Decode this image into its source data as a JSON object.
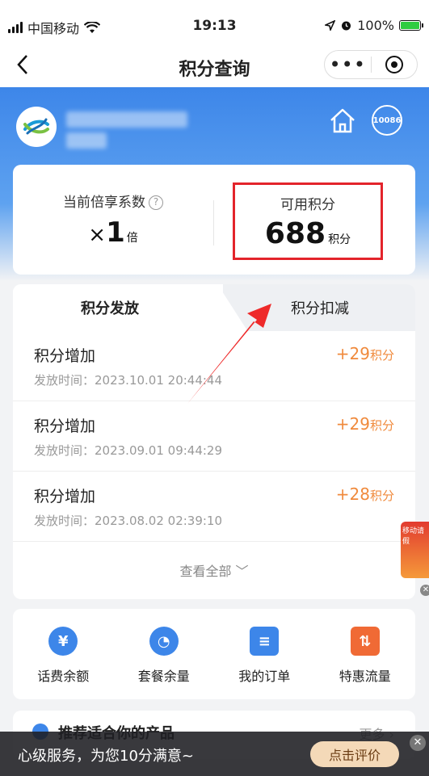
{
  "status_bar": {
    "carrier": "中国移动",
    "time": "19:13",
    "battery": "100%"
  },
  "nav": {
    "title": "积分查询",
    "more_icon": "•••"
  },
  "hero": {
    "service_icon": "10086"
  },
  "points": {
    "coef_label": "当前倍享系数",
    "coef_prefix": "×",
    "coef_value": "1",
    "coef_unit": "倍",
    "available_label": "可用积分",
    "available_value": "688",
    "available_unit": "积分"
  },
  "tabs": {
    "issue": "积分发放",
    "deduct": "积分扣减"
  },
  "records": [
    {
      "name": "积分增加",
      "time": "发放时间：2023.10.01 20:44:44",
      "points": "+29",
      "unit": "积分"
    },
    {
      "name": "积分增加",
      "time": "发放时间：2023.09.01 09:44:29",
      "points": "+29",
      "unit": "积分"
    },
    {
      "name": "积分增加",
      "time": "发放时间：2023.08.02 02:39:10",
      "points": "+28",
      "unit": "积分"
    }
  ],
  "view_all": "查看全部 ﹀",
  "shortcuts": [
    {
      "label": "话费余额",
      "icon": "¥",
      "color": "#3d86e9"
    },
    {
      "label": "套餐余量",
      "icon": "◔",
      "color": "#3d86e9"
    },
    {
      "label": "我的订单",
      "icon": "≡",
      "color": "#3d86e9"
    },
    {
      "label": "特惠流量",
      "icon": "⇅",
      "color": "#f06a35"
    }
  ],
  "recommend": {
    "title": "推荐适合你的产品",
    "more": "更多 ›"
  },
  "bottom_bar": {
    "text": "心级服务，为您10分满意~",
    "button": "点击评价",
    "close": "✕"
  },
  "float_ad": {
    "text": "移动请假"
  },
  "colors": {
    "primary": "#3d86e9",
    "points_orange": "#f08a3c",
    "highlight_red": "#e3242b"
  }
}
